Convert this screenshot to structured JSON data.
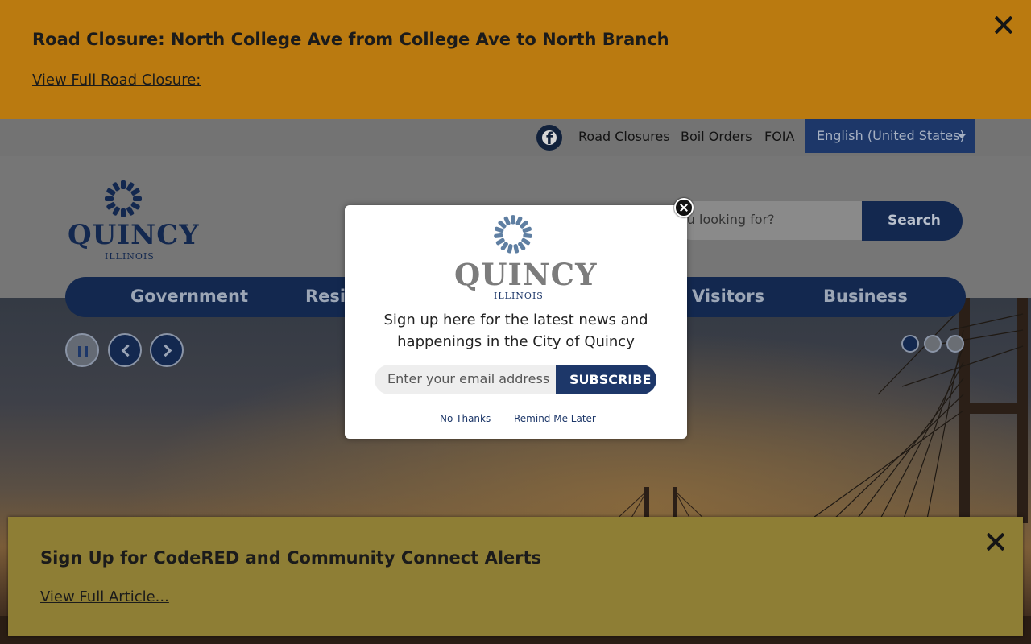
{
  "top_alert": {
    "title": "Road Closure: North College Ave from College Ave to North Branch",
    "link_text": "View Full Road Closure:",
    "close_icon": "close-icon",
    "background": "#ba7a10"
  },
  "utility_bar": {
    "social_icon": "facebook-icon",
    "links": [
      "Road Closures",
      "Boil Orders",
      "FOIA"
    ],
    "language_selected": "English (United States)"
  },
  "header": {
    "logo": {
      "word": "QUINCY",
      "sub": "ILLINOIS"
    },
    "search": {
      "placeholder_visible": "ou looking for?",
      "button_label": "Search"
    }
  },
  "nav": {
    "items": [
      "Government",
      "Resi",
      "Visitors",
      "Business"
    ]
  },
  "hero": {
    "controls": [
      "pause-icon",
      "chevron-left-icon",
      "chevron-right-icon"
    ],
    "slide_count": 3,
    "active_slide": 1
  },
  "modal": {
    "logo": {
      "word": "QUINCY",
      "sub": "ILLINOIS"
    },
    "message": "Sign up here for the latest news and happenings in the City of Quincy",
    "email_placeholder": "Enter your email address",
    "subscribe_label": "SUBSCRIBE",
    "no_thanks": "No Thanks",
    "remind_later": "Remind Me Later"
  },
  "bottom_alert": {
    "title": "Sign Up for CodeRED and Community Connect Alerts",
    "link_text": "View Full Article...",
    "close_icon": "close-icon",
    "background": "#8e7e35"
  },
  "colors": {
    "brand_navy": "#1d3769",
    "alert_orange": "#ba7a10",
    "alert_olive": "#8e7e35"
  }
}
